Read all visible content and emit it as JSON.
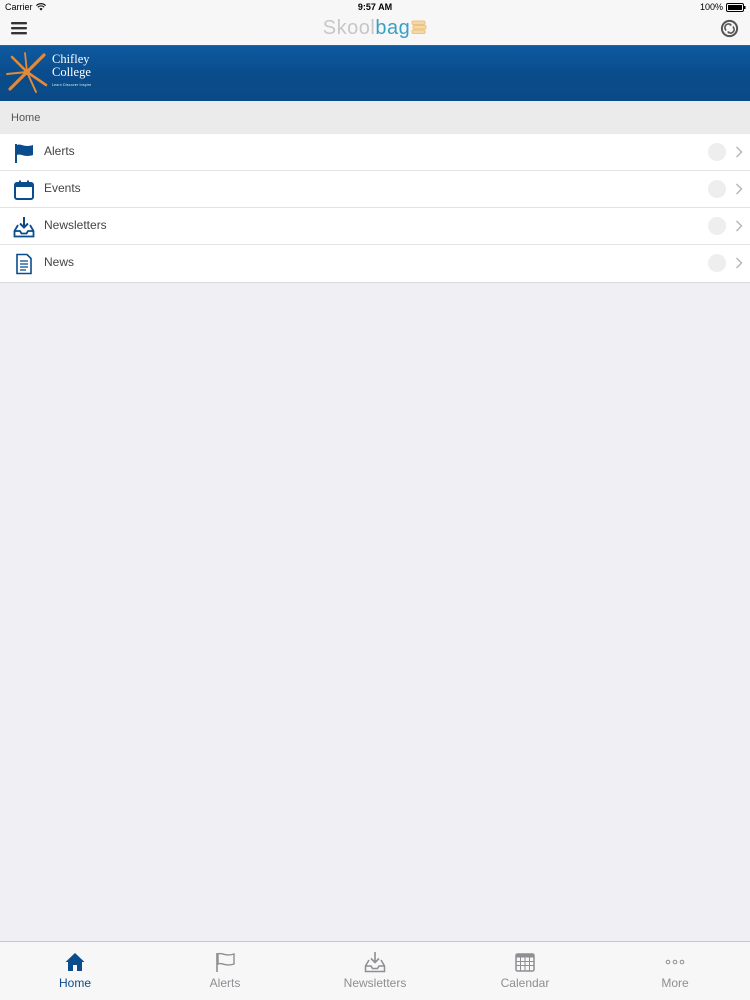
{
  "status_bar": {
    "carrier": "Carrier",
    "time": "9:57 AM",
    "battery": "100%"
  },
  "nav_bar": {
    "logo_part1": "Skool",
    "logo_part2": "bag",
    "menu_icon": "hamburger-icon",
    "sync_icon": "sync-icon"
  },
  "banner": {
    "school_name_line1": "Chifley",
    "school_name_line2": "College",
    "tagline": "Learn Discover Inspire",
    "background_color": "#0a4c8c",
    "logo_color": "#e08a3a"
  },
  "breadcrumb": {
    "label": "Home"
  },
  "menu": {
    "items": [
      {
        "label": "Alerts",
        "icon": "flag-icon"
      },
      {
        "label": "Events",
        "icon": "calendar-icon"
      },
      {
        "label": "Newsletters",
        "icon": "inbox-download-icon"
      },
      {
        "label": "News",
        "icon": "document-icon"
      }
    ]
  },
  "tabs": [
    {
      "label": "Home",
      "icon": "home-icon",
      "active": true
    },
    {
      "label": "Alerts",
      "icon": "flag-icon",
      "active": false
    },
    {
      "label": "Newsletters",
      "icon": "inbox-download-icon",
      "active": false
    },
    {
      "label": "Calendar",
      "icon": "calendar-grid-icon",
      "active": false
    },
    {
      "label": "More",
      "icon": "more-dots-icon",
      "active": false
    }
  ],
  "colors": {
    "accent": "#0a4c8c",
    "tab_inactive": "#8e8e93",
    "brand_blue": "#36a1c6"
  }
}
